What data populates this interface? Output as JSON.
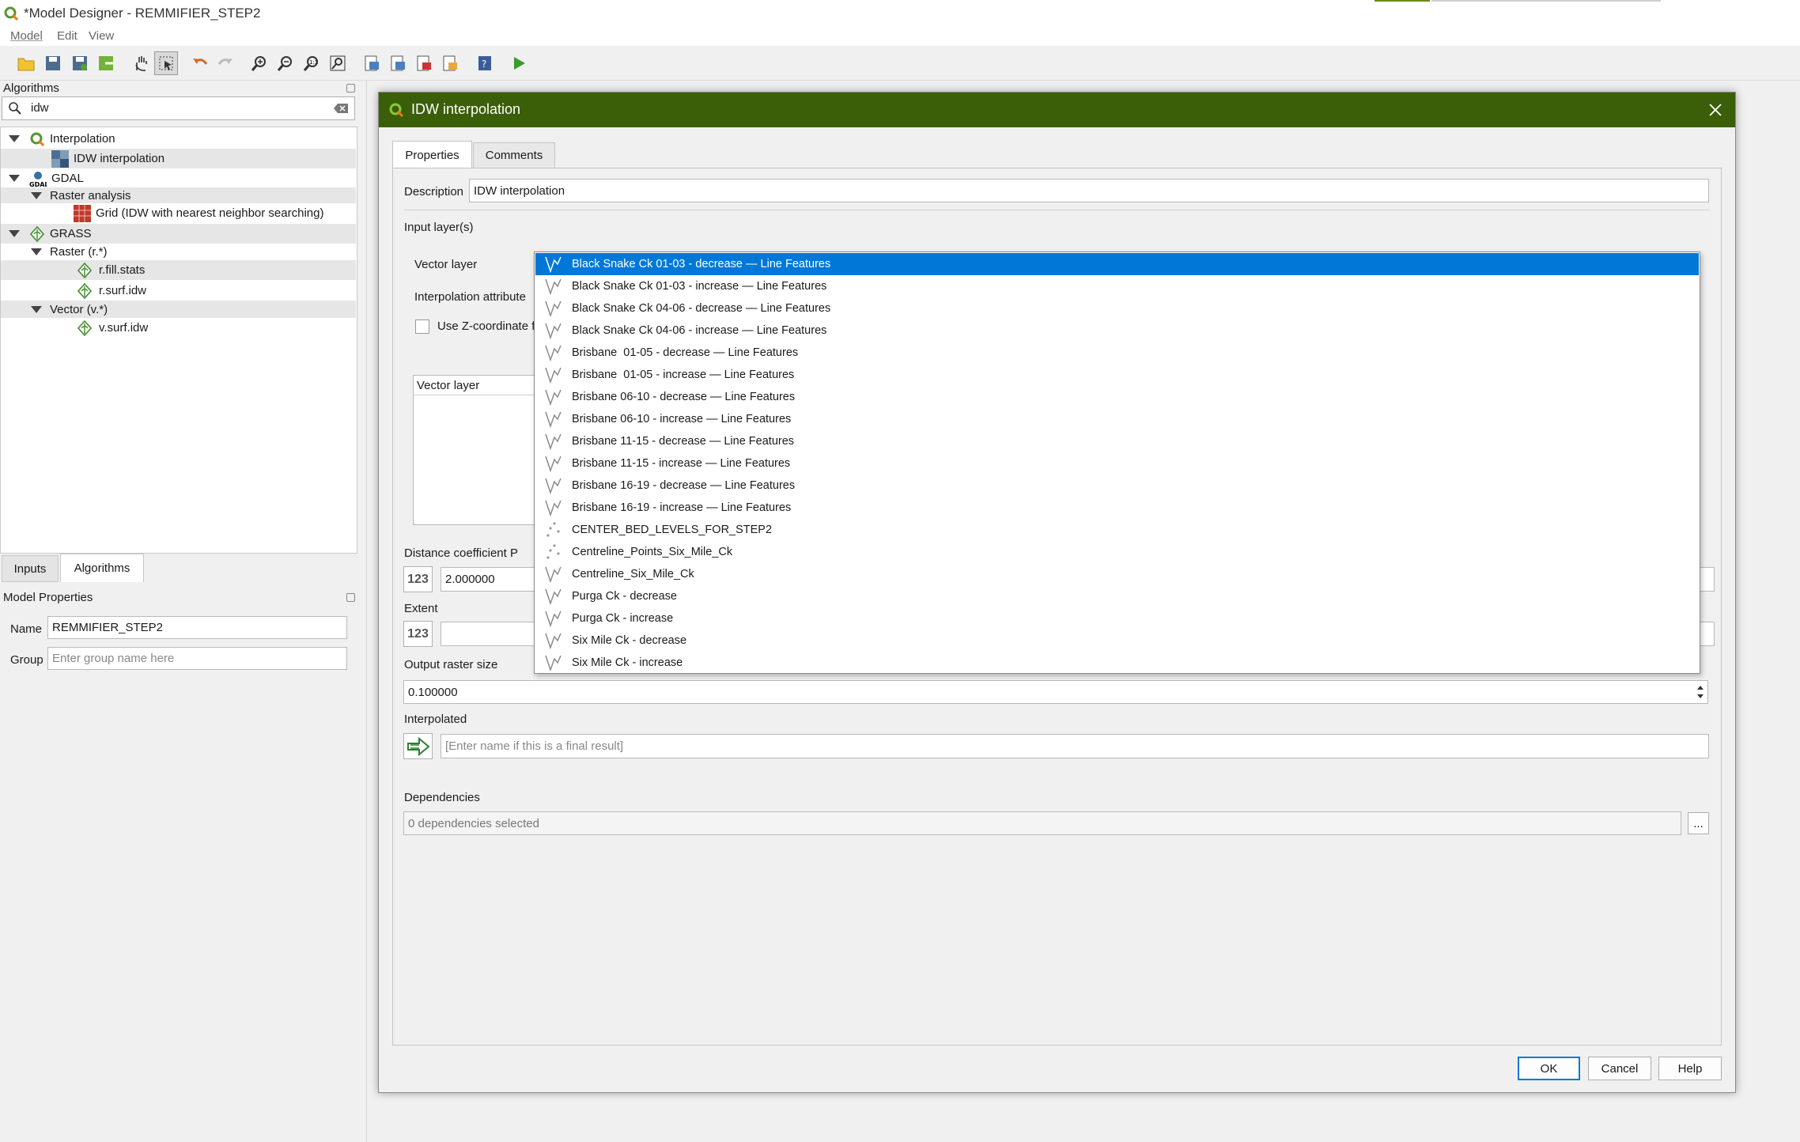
{
  "window": {
    "title": "*Model Designer - REMMIFIER_STEP2"
  },
  "menu": [
    "Model",
    "Edit",
    "View"
  ],
  "toolbar_icons": [
    "open-icon",
    "save-icon",
    "save-as-icon",
    "export-image-icon",
    "pan-icon",
    "select-icon",
    "undo-icon",
    "redo-icon",
    "zoom-in-icon",
    "zoom-out-icon",
    "zoom-actual-icon",
    "zoom-full-icon",
    "export-pdf-icon",
    "export-svg-icon",
    "export-python-icon",
    "export-script-icon",
    "help-icon",
    "run-icon"
  ],
  "algorithms_panel": {
    "title": "Algorithms",
    "search_value": "idw",
    "tree": [
      {
        "label": "Interpolation",
        "level": 0,
        "icon": "qgis-icon"
      },
      {
        "label": "IDW interpolation",
        "level": 1,
        "icon": "idw-icon"
      },
      {
        "label": "GDAL",
        "level": 0,
        "icon": "gdal-icon"
      },
      {
        "label": "Raster analysis",
        "level": 1,
        "icon": ""
      },
      {
        "label": "Grid (IDW with nearest neighbor searching)",
        "level": 2,
        "icon": "grid-icon"
      },
      {
        "label": "GRASS",
        "level": 0,
        "icon": "grass-icon"
      },
      {
        "label": "Raster (r.*)",
        "level": 1,
        "icon": ""
      },
      {
        "label": "r.fill.stats",
        "level": 2,
        "icon": "grass-icon"
      },
      {
        "label": "r.surf.idw",
        "level": 2,
        "icon": "grass-icon"
      },
      {
        "label": "Vector (v.*)",
        "level": 1,
        "icon": ""
      },
      {
        "label": "v.surf.idw",
        "level": 2,
        "icon": "grass-icon"
      }
    ]
  },
  "bottom_tabs": [
    "Inputs",
    "Algorithms"
  ],
  "model_properties": {
    "title": "Model Properties",
    "name_label": "Name",
    "name_value": "REMMIFIER_STEP2",
    "group_label": "Group",
    "group_placeholder": "Enter group name here"
  },
  "dialog": {
    "title": "IDW interpolation",
    "tabs": [
      "Properties",
      "Comments"
    ],
    "description_label": "Description",
    "description_value": "IDW interpolation",
    "input_layers_label": "Input layer(s)",
    "vector_layer_label": "Vector layer",
    "interpolation_attribute_label": "Interpolation attribute",
    "use_z_label": "Use Z-coordinate fo",
    "table_header": "Vector layer",
    "distance_label": "Distance coefficient P",
    "distance_value": "2.000000",
    "extent_label": "Extent",
    "output_size_label": "Output raster size",
    "output_size_value": "0.100000",
    "interpolated_label": "Interpolated",
    "interpolated_placeholder": "[Enter name if this is a final result]",
    "dependencies_label": "Dependencies",
    "dependencies_value": "0 dependencies selected",
    "dependencies_button": "...",
    "ok": "OK",
    "cancel": "Cancel",
    "help": "Help",
    "number_badge": "123"
  },
  "dropdown": {
    "selected_index": 0,
    "items": [
      {
        "label": "Black Snake Ck 01-03 - decrease — Line Features",
        "icon": "line-layer-icon"
      },
      {
        "label": "Black Snake Ck 01-03 - increase — Line Features",
        "icon": "line-layer-icon"
      },
      {
        "label": "Black Snake Ck 04-06 - decrease — Line Features",
        "icon": "line-layer-icon"
      },
      {
        "label": "Black Snake Ck 04-06 - increase — Line Features",
        "icon": "line-layer-icon"
      },
      {
        "label": "Brisbane  01-05 - decrease — Line Features",
        "icon": "line-layer-icon"
      },
      {
        "label": "Brisbane  01-05 - increase — Line Features",
        "icon": "line-layer-icon"
      },
      {
        "label": "Brisbane 06-10 - decrease — Line Features",
        "icon": "line-layer-icon"
      },
      {
        "label": "Brisbane 06-10 - increase — Line Features",
        "icon": "line-layer-icon"
      },
      {
        "label": "Brisbane 11-15 - decrease — Line Features",
        "icon": "line-layer-icon"
      },
      {
        "label": "Brisbane 11-15 - increase — Line Features",
        "icon": "line-layer-icon"
      },
      {
        "label": "Brisbane 16-19 - decrease — Line Features",
        "icon": "line-layer-icon"
      },
      {
        "label": "Brisbane 16-19 - increase — Line Features",
        "icon": "line-layer-icon"
      },
      {
        "label": "CENTER_BED_LEVELS_FOR_STEP2",
        "icon": "point-layer-icon"
      },
      {
        "label": "Centreline_Points_Six_Mile_Ck",
        "icon": "point-layer-icon"
      },
      {
        "label": "Centreline_Six_Mile_Ck",
        "icon": "line-layer-icon"
      },
      {
        "label": "Purga Ck - decrease",
        "icon": "line-layer-icon"
      },
      {
        "label": "Purga Ck - increase",
        "icon": "line-layer-icon"
      },
      {
        "label": "Six Mile Ck - decrease",
        "icon": "line-layer-icon"
      },
      {
        "label": "Six Mile Ck - increase",
        "icon": "line-layer-icon"
      }
    ]
  },
  "colors": {
    "dialog_titlebar": "#3b5e08",
    "selection": "#0078d7",
    "ok_border": "#0078d7"
  }
}
